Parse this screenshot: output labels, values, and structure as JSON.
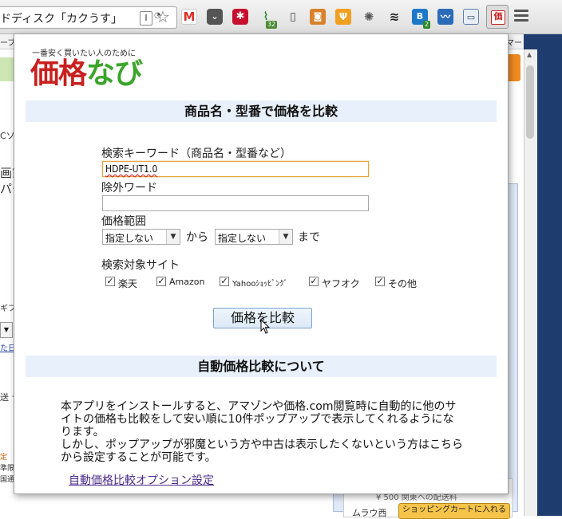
{
  "browser": {
    "address_text": "ドディスク「カクうす」",
    "bookmark_left": "ーブ",
    "bookmark_right": "マーク",
    "extension_badges": {
      "mail": "M",
      "count_32": "32",
      "b2": "B",
      "b2_badge": "2"
    }
  },
  "background_page": {
    "texts": [
      "Cソフ",
      "画家",
      "パー",
      "ギフ",
      "た日",
      "送 テ",
      "定",
      "準限",
      "国通"
    ],
    "price_text": "¥ 500 関東への配送料",
    "cart_button": "ショッピングカートに入れる",
    "seller_text": "ムラウ西"
  },
  "popup": {
    "tagline": "一番安く買いたい人のために",
    "logo_part1": "価格",
    "logo_part2": "なび",
    "section1_title": "商品名・型番で価格を比較",
    "keyword_label": "検索キーワード（商品名・型番など）",
    "keyword_value": "HDPE-UT1.0",
    "exclude_label": "除外ワード",
    "exclude_value": "",
    "price_range_label": "価格範囲",
    "price_min_selected": "指定しない",
    "from_label": "から",
    "price_max_selected": "指定しない",
    "to_label": "まで",
    "sites_label": "検索対象サイト",
    "sites": [
      {
        "label": "楽天",
        "checked": true
      },
      {
        "label": "Amazon",
        "checked": true
      },
      {
        "label": "Yahooｼｮｯﾋﾟﾝｸﾞ",
        "checked": true
      },
      {
        "label": "ヤフオク",
        "checked": true
      },
      {
        "label": "その他",
        "checked": true
      }
    ],
    "compare_button": "価格を比較",
    "section2_title": "自動価格比較について",
    "description_p1": "本アプリをインストールすると、アマゾンや価格.com閲覧時に自動的に他のサイトの価格も比較をして安い順に10件ポップアップで表示してくれるようになります。",
    "description_p2": "しかし、ポップアップが邪魔という方や中古は表示したくないという方はこちらから設定することが可能です。",
    "options_link": "自動価格比較オプション設定"
  },
  "colors": {
    "logo_red": "#c8201e",
    "logo_green": "#3aa42b",
    "section_bg": "#e8f0fb",
    "link": "#4b2a8a"
  }
}
